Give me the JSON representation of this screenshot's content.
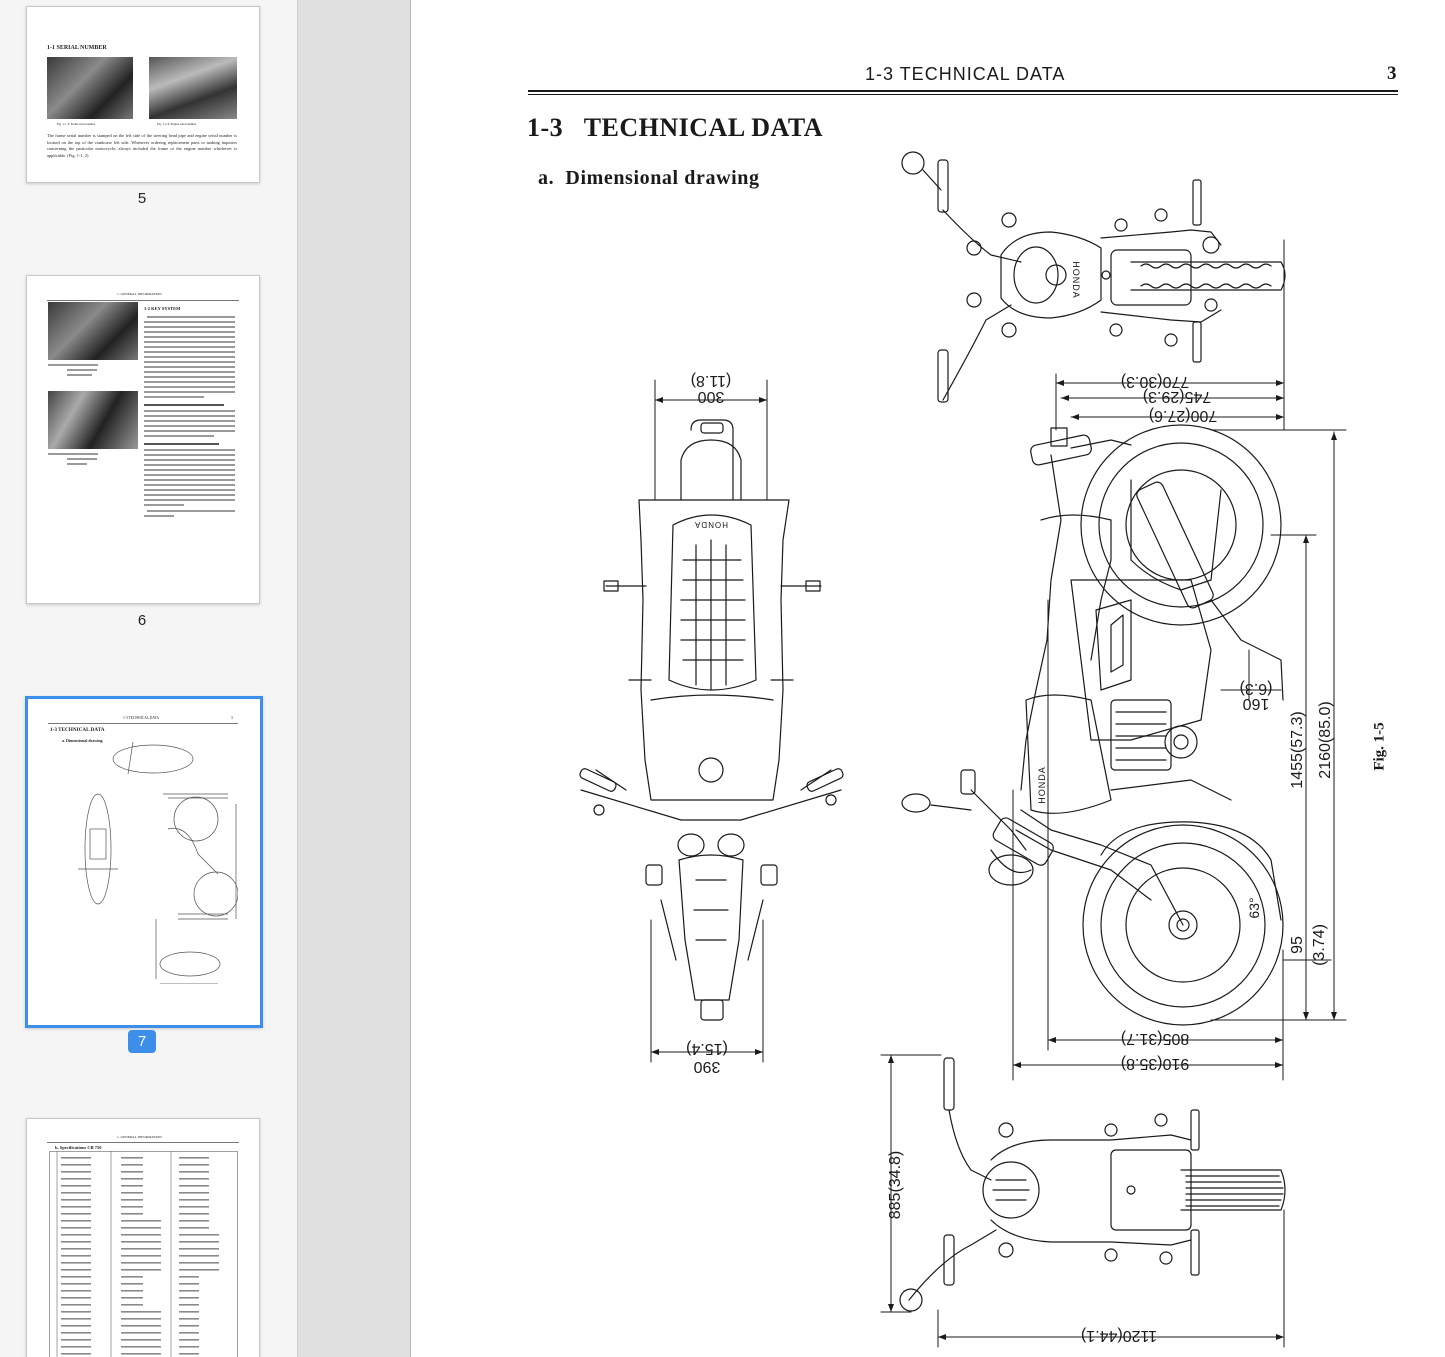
{
  "sidebar": {
    "thumbnails": [
      {
        "page_number": "5",
        "heading": "1-1  SERIAL NUMBER",
        "captions": [
          "Fig. 1-1  ① Frame serial number",
          "Fig. 1-2  ① Engine serial number"
        ],
        "body": "The frame serial number is stamped on the left side of the steering head pipe and engine serial number is located on the top of the crankcase left side. Whenever ordering replacement parts or making inquiries concerning the particular motorcycle, always included the frame or the engine number whichever is applicable. (Fig. 1-1, 2)"
      },
      {
        "page_number": "6",
        "header": "1. GENERAL INFORMATION",
        "heading": "1-2  KEY SYSTEM"
      },
      {
        "page_number": "7",
        "header": "1-3  TECHNICAL DATA",
        "heading": "1-3  TECHNICAL DATA",
        "subheading": "a.  Dimensional drawing",
        "selected": true
      },
      {
        "page_number": "",
        "header": "1. GENERAL INFORMATION",
        "heading": "b.  Specifications CB 750"
      }
    ]
  },
  "page": {
    "running_header": "1-3   TECHNICAL DATA",
    "page_number": "3",
    "title": "1-3   TECHNICAL DATA",
    "subtitle": "a.  Dimensional drawing",
    "figure_label": "Fig. 1-5",
    "dimensions": {
      "width_top": "300",
      "width_top_in": "(11.8)",
      "width_bottom": "390",
      "width_bottom_in": "(15.4)",
      "d770": "770(30.3)",
      "d745": "745(29.3)",
      "d700": "700(27.6)",
      "d160": "160",
      "d160_in": "(6.3)",
      "d1455": "1455(57.3)",
      "d2160": "2160(85.0)",
      "d63": "63°",
      "d95": "95",
      "d95_in": "(3.74)",
      "d805": "805(31.7)",
      "d910": "910(35.8)",
      "d885": "885(34.8)",
      "d1120": "1120(44.1)"
    },
    "brand_marks": [
      "HONDA",
      "HONDA",
      "HONDA"
    ]
  },
  "colors": {
    "selection_blue": "#3b8fe9",
    "sidebar_bg": "#f5f5f5",
    "gutter_bg": "#e0e0e0",
    "ink": "#1a1a1a"
  }
}
